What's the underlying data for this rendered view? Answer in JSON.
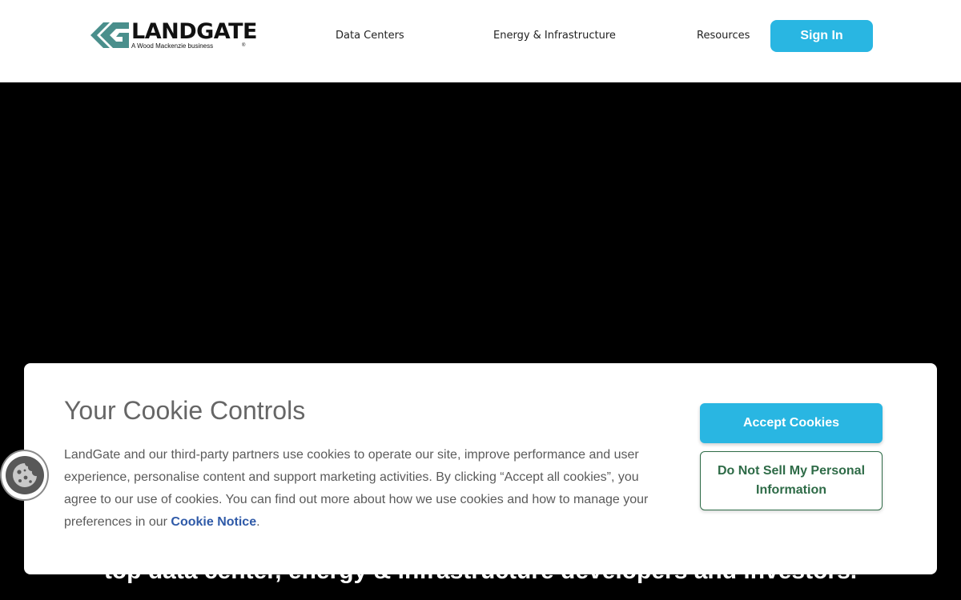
{
  "header": {
    "logo": {
      "word": "LANDGATE",
      "tagline": "A Wood Mackenzie business",
      "reg": "®"
    },
    "nav": [
      {
        "label": "Data Centers"
      },
      {
        "label": "Energy & Infrastructure"
      },
      {
        "label": "Resources"
      }
    ],
    "signin_label": "Sign In"
  },
  "hero": {
    "subtitle": "top data center, energy & infrastructure developers and investors."
  },
  "cookie_dialog": {
    "title": "Your Cookie Controls",
    "body": "LandGate and our third-party partners use cookies to operate our site, improve performance and user experience, personalise content and support marketing activities. By clicking “Accept all cookies”, you agree to our use of cookies. You can find out more about how we use cookies and how to manage your preferences in our ",
    "link_label": "Cookie Notice",
    "body_end": ".",
    "accept_label": "Accept Cookies",
    "donotsell_label": "Do Not Sell My Personal Information"
  },
  "colors": {
    "accent": "#29b6e2",
    "logo_teal": "#4a8f8c",
    "link": "#2f5aa8",
    "donotsell": "#2e6b47"
  },
  "icons": {
    "cookie_settings": "cookie-icon"
  }
}
